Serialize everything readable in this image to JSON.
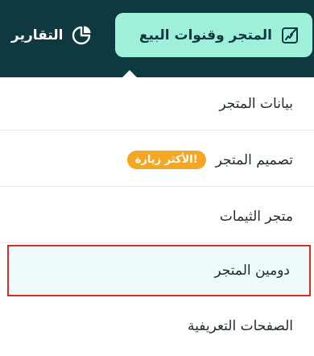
{
  "colors": {
    "topbar_bg": "#0e3941",
    "active_tab_bg": "#9ef0d8",
    "badge_bg": "#f5a623",
    "highlight_border": "#d92b2b",
    "highlight_bg": "#edfcf8"
  },
  "nav": {
    "store_tab": {
      "label": "المتجر وقنوات البيع",
      "icon": "store-share-icon",
      "active": true
    },
    "reports_tab": {
      "label": "التقارير",
      "icon": "pie-chart-icon"
    }
  },
  "menu": {
    "items": [
      {
        "label": "بيانات المتجر"
      },
      {
        "label": "تصميم المتجر",
        "badge": "الأكثر زيارة!"
      },
      {
        "label": "متجر الثيمات"
      },
      {
        "label": "دومين المتجر",
        "highlighted": true
      },
      {
        "label": "الصفحات التعريفية"
      }
    ]
  }
}
